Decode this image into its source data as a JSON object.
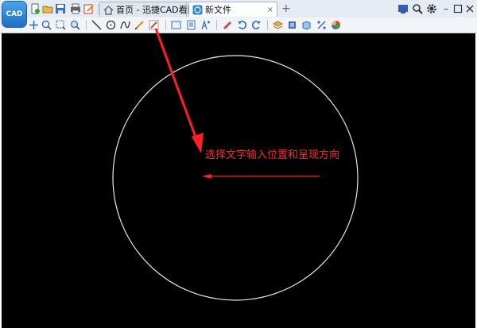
{
  "app": {
    "logo_text": "CAD"
  },
  "tabs": [
    {
      "label": "首页 - 迅捷CAD看图",
      "close": "×",
      "icon": "home-icon"
    },
    {
      "label": "新文件",
      "close": "×",
      "icon": "document-icon"
    }
  ],
  "new_tab": "+",
  "window_controls": {
    "minimize": "–"
  },
  "canvas": {
    "annotation": "选择文字输入位置和呈现方向",
    "background": "#000000",
    "circle_color": "#ffffff",
    "annotation_color": "#ff2a2a"
  },
  "colors": {
    "accent": "#1e6fc2",
    "arrow": "#ff2020"
  }
}
